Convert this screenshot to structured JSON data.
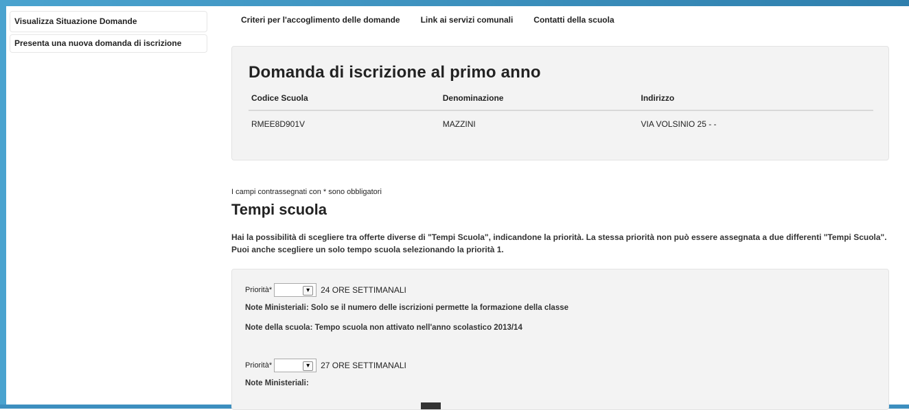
{
  "sidebar": {
    "items": [
      {
        "label": "Visualizza Situazione Domande"
      },
      {
        "label": "Presenta una nuova domanda di iscrizione"
      }
    ]
  },
  "topnav": {
    "links": [
      {
        "label": "Criteri per l'accoglimento delle domande"
      },
      {
        "label": "Link ai servizi comunali"
      },
      {
        "label": "Contatti della scuola"
      }
    ]
  },
  "panel": {
    "title": "Domanda di iscrizione al primo anno",
    "columns": [
      "Codice Scuola",
      "Denominazione",
      "Indirizzo"
    ],
    "row": [
      "RMEE8D901V",
      "MAZZINI",
      "VIA VOLSINIO 25 - -"
    ]
  },
  "form": {
    "required_note": "I campi contrassegnati con * sono obbligatori",
    "section_title": "Tempi scuola",
    "intro": "Hai la possibilità di scegliere tra offerte diverse di \"Tempi Scuola\", indicandone la priorità. La stessa priorità non può essere assegnata a due differenti \"Tempi Scuola\". Puoi anche scegliere un solo tempo scuola selezionando la priorità 1.",
    "options": [
      {
        "priority_label": "Priorità*",
        "selected": "",
        "value": "24 ORE SETTIMANALI",
        "note_ministeriali": "Note Ministeriali: Solo se il numero delle iscrizioni permette la formazione della classe",
        "note_scuola": "Note della scuola: Tempo scuola non attivato nell'anno scolastico 2013/14"
      },
      {
        "priority_label": "Priorità*",
        "selected": "",
        "value": "27 ORE SETTIMANALI",
        "note_ministeriali": "Note Ministeriali:"
      }
    ]
  },
  "colors": {
    "frame": "#4aa3cf",
    "panel_bg": "#f3f3f3"
  }
}
